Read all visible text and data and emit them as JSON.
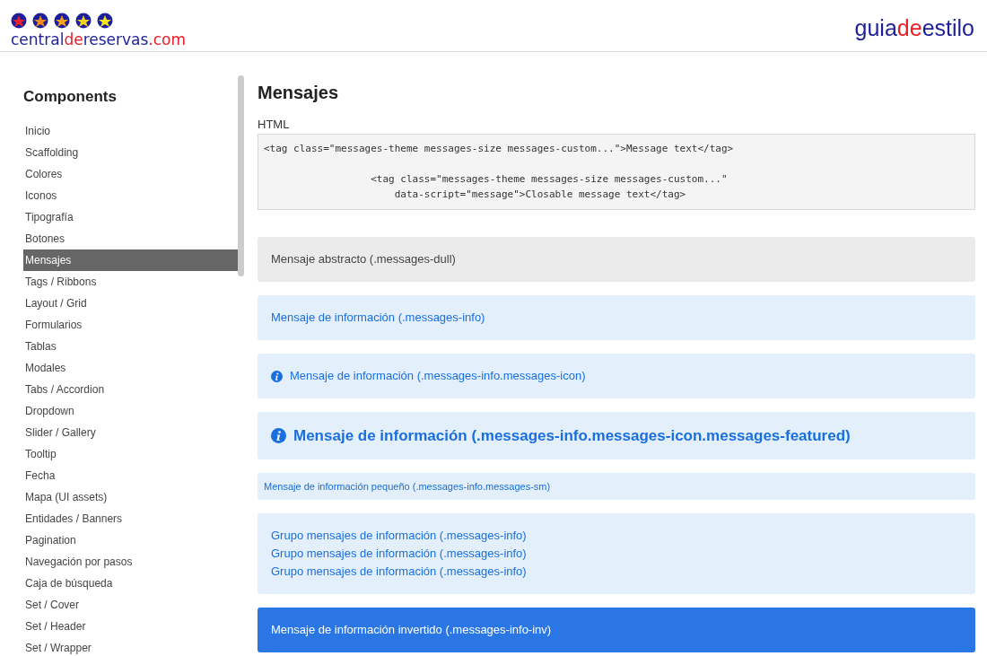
{
  "header": {
    "logo_parts": [
      {
        "text": "central",
        "accent": false
      },
      {
        "text": "de",
        "accent": true
      },
      {
        "text": "reservas",
        "accent": false
      },
      {
        "text": ".com",
        "accent": true
      }
    ],
    "brand_parts": [
      {
        "text": "guia",
        "accent": false
      },
      {
        "text": "de",
        "accent": true
      },
      {
        "text": "estilo",
        "accent": false
      }
    ]
  },
  "sidebar": {
    "title": "Components",
    "items": [
      {
        "label": "Inicio",
        "selected": false
      },
      {
        "label": "Scaffolding",
        "selected": false
      },
      {
        "label": "Colores",
        "selected": false
      },
      {
        "label": "Iconos",
        "selected": false
      },
      {
        "label": "Tipografía",
        "selected": false
      },
      {
        "label": "Botones",
        "selected": false
      },
      {
        "label": "Mensajes",
        "selected": true
      },
      {
        "label": "Tags / Ribbons",
        "selected": false
      },
      {
        "label": "Layout / Grid",
        "selected": false
      },
      {
        "label": "Formularios",
        "selected": false
      },
      {
        "label": "Tablas",
        "selected": false
      },
      {
        "label": "Modales",
        "selected": false
      },
      {
        "label": "Tabs / Accordion",
        "selected": false
      },
      {
        "label": "Dropdown",
        "selected": false
      },
      {
        "label": "Slider / Gallery",
        "selected": false
      },
      {
        "label": "Tooltip",
        "selected": false
      },
      {
        "label": "Fecha",
        "selected": false
      },
      {
        "label": "Mapa (UI assets)",
        "selected": false
      },
      {
        "label": "Entidades / Banners",
        "selected": false
      },
      {
        "label": "Pagination",
        "selected": false
      },
      {
        "label": "Navegación por pasos",
        "selected": false
      },
      {
        "label": "Caja de búsqueda",
        "selected": false
      },
      {
        "label": "Set / Cover",
        "selected": false
      },
      {
        "label": "Set / Header",
        "selected": false
      },
      {
        "label": "Set / Wrapper",
        "selected": false
      }
    ]
  },
  "main": {
    "title": "Mensajes",
    "code_label": "HTML",
    "code": "<tag class=\"messages-theme messages-size messages-custom...\">Message text</tag>\n\n                  <tag class=\"messages-theme messages-size messages-custom...\"\n                      data-script=\"message\">Closable message text</tag>",
    "messages": [
      {
        "kind": "dull",
        "lines": [
          "Mensaje abstracto (.messages-dull)"
        ]
      },
      {
        "kind": "info",
        "lines": [
          "Mensaje de información (.messages-info)"
        ]
      },
      {
        "kind": "icon",
        "lines": [
          "Mensaje de información (.messages-info.messages-icon)"
        ]
      },
      {
        "kind": "featured",
        "lines": [
          "Mensaje de información (.messages-info.messages-icon.messages-featured)"
        ]
      },
      {
        "kind": "small",
        "lines": [
          "Mensaje de información pequeño (.messages-info.messages-sm)"
        ]
      },
      {
        "kind": "info",
        "lines": [
          "Grupo mensajes de información (.messages-info)",
          "Grupo mensajes de información (.messages-info)",
          "Grupo mensajes de información (.messages-info)"
        ]
      },
      {
        "kind": "inverted",
        "lines": [
          "Mensaje de información invertido (.messages-info-inv)"
        ]
      }
    ]
  }
}
